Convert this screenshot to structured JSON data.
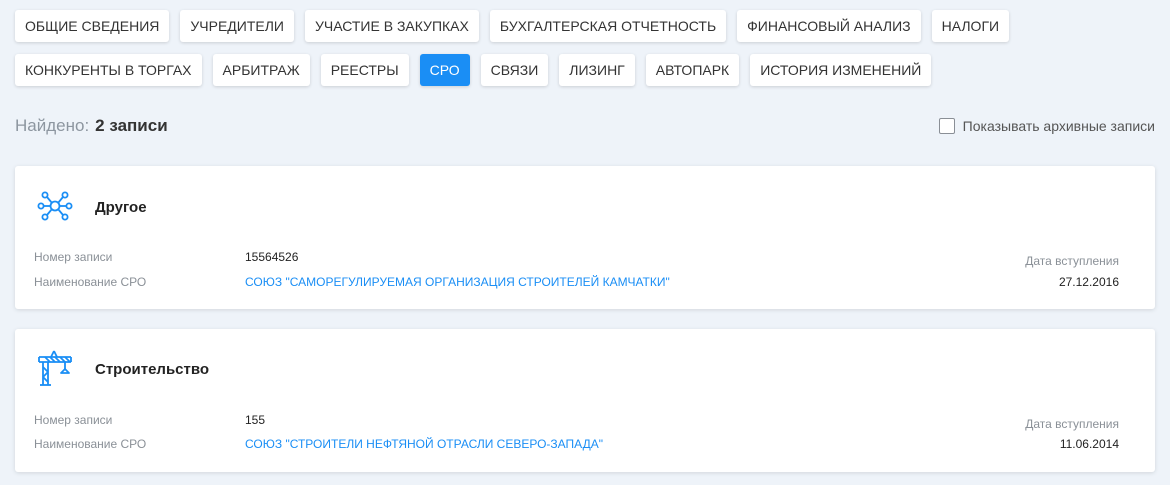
{
  "tabs_row1": [
    "ОБЩИЕ СВЕДЕНИЯ",
    "УЧРЕДИТЕЛИ",
    "УЧАСТИЕ В ЗАКУПКАХ",
    "БУХГАЛТЕРСКАЯ ОТЧЕТНОСТЬ",
    "ФИНАНСОВЫЙ АНАЛИЗ",
    "НАЛОГИ"
  ],
  "tabs_row2": [
    "КОНКУРЕНТЫ В ТОРГАХ",
    "АРБИТРАЖ",
    "РЕЕСТРЫ",
    "СРО",
    "СВЯЗИ",
    "ЛИЗИНГ",
    "АВТОПАРК",
    "ИСТОРИЯ ИЗМЕНЕНИЙ"
  ],
  "active_tab": "СРО",
  "found": {
    "label": "Найдено:",
    "count": "2 записи"
  },
  "archive": {
    "label": "Показывать архивные записи",
    "checked": false
  },
  "accent_color": "#1a8ef5",
  "records": [
    {
      "icon": "network-icon",
      "title": "Другое",
      "number_label": "Номер записи",
      "number": "15564526",
      "name_label": "Наименование СРО",
      "name": "СОЮЗ \"САМОРЕГУЛИРУЕМАЯ ОРГАНИЗАЦИЯ СТРОИТЕЛЕЙ КАМЧАТКИ\"",
      "date_label": "Дата вступления",
      "date": "27.12.2016"
    },
    {
      "icon": "crane-icon",
      "title": "Строительство",
      "number_label": "Номер записи",
      "number": "155",
      "name_label": "Наименование СРО",
      "name": "СОЮЗ \"СТРОИТЕЛИ НЕФТЯНОЙ ОТРАСЛИ СЕВЕРО-ЗАПАДА\"",
      "date_label": "Дата вступления",
      "date": "11.06.2014"
    }
  ]
}
